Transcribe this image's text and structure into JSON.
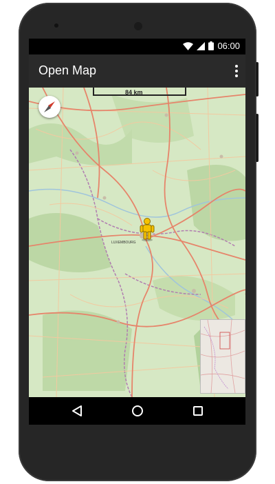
{
  "status_bar": {
    "time": "06:00"
  },
  "app_bar": {
    "title": "Open Map"
  },
  "map": {
    "scale_label": "84 km",
    "city_label": "LUXEMBOURG",
    "colors": {
      "land": "#d6e8c4",
      "road_major": "#e6846a",
      "road_minor": "#f2c9a0",
      "forest": "#b5d29e",
      "border": "#b07cb0"
    }
  },
  "icons": {
    "menu": "overflow-menu-icon",
    "compass": "compass-icon",
    "person": "pegman-icon",
    "back": "back-icon",
    "home": "home-icon",
    "recents": "recents-icon"
  }
}
